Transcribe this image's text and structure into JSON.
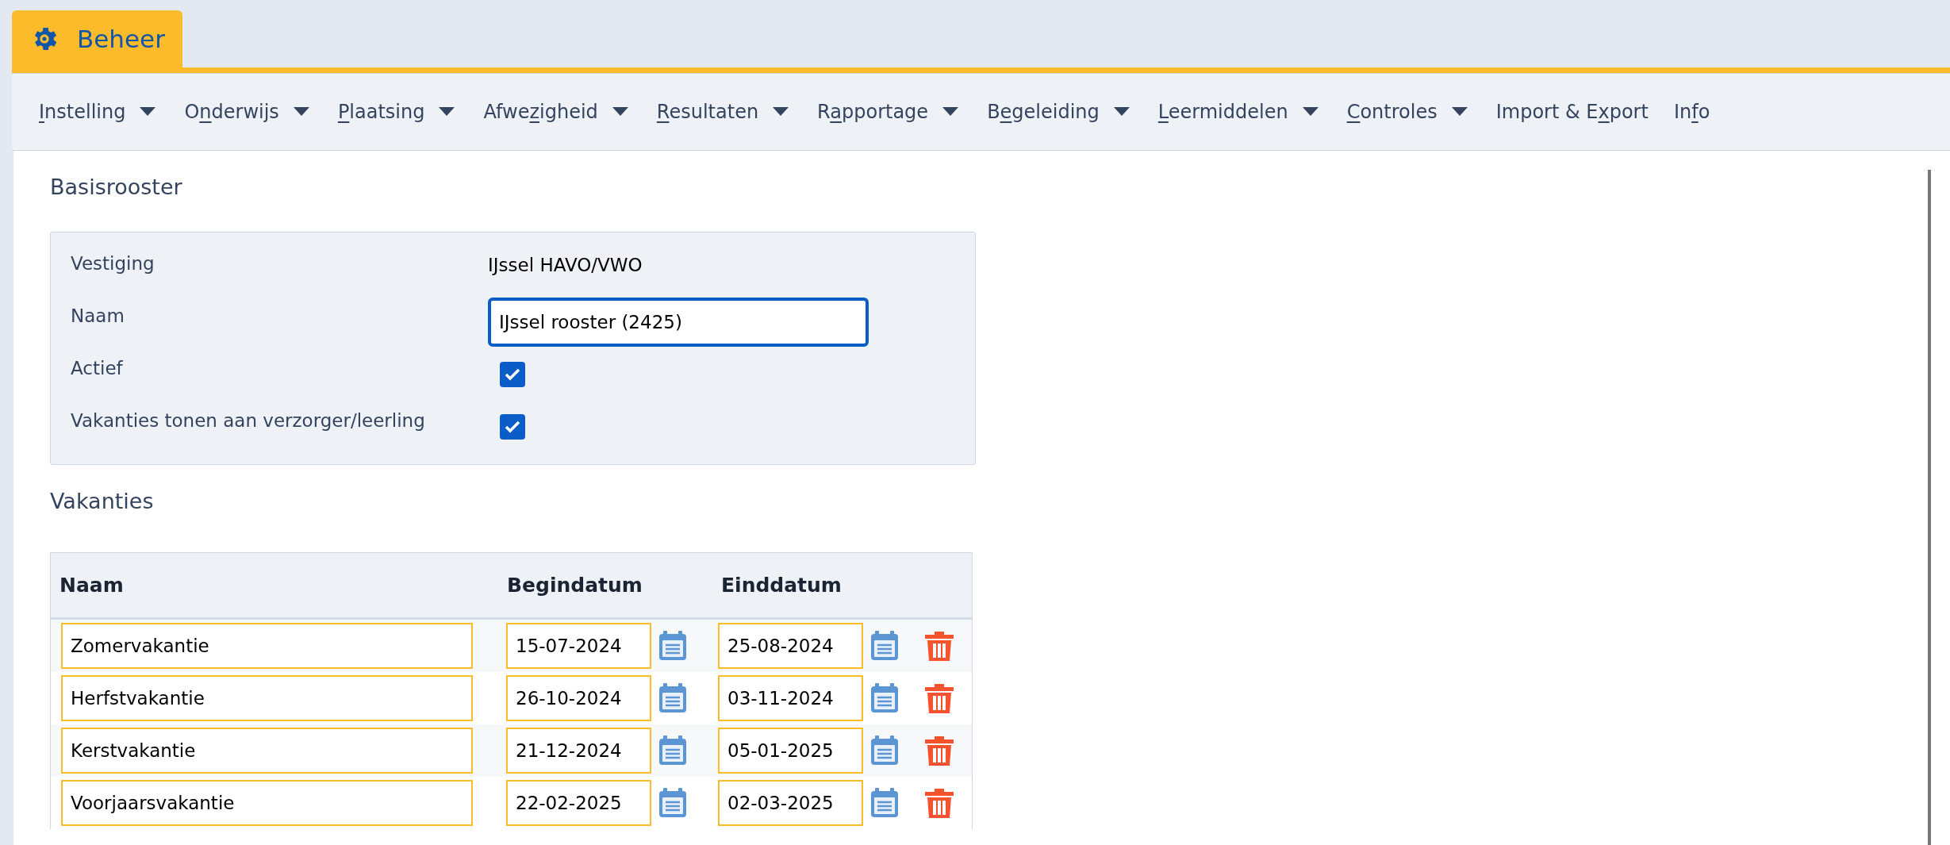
{
  "app_tab": {
    "label": "Beheer",
    "selected": true
  },
  "menu": [
    {
      "key": "I",
      "post": "nstelling",
      "dropdown": true
    },
    {
      "pre": "O",
      "key": "n",
      "post": "derwijs",
      "dropdown": true
    },
    {
      "key": "P",
      "post": "laatsing",
      "dropdown": true
    },
    {
      "pre": "Afwe",
      "key": "z",
      "post": "igheid",
      "dropdown": true
    },
    {
      "key": "R",
      "post": "esultaten",
      "dropdown": true
    },
    {
      "pre": "R",
      "key": "a",
      "post": "pportage",
      "dropdown": true
    },
    {
      "pre": "B",
      "key": "e",
      "post": "geleiding",
      "dropdown": true
    },
    {
      "key": "L",
      "post": "eermiddelen",
      "dropdown": true
    },
    {
      "key": "C",
      "post": "ontroles",
      "dropdown": true
    },
    {
      "pre": "Import & E",
      "key": "x",
      "post": "port",
      "dropdown": false
    },
    {
      "pre": "In",
      "key": "f",
      "post": "o",
      "dropdown": false
    }
  ],
  "basisrooster": {
    "title": "Basisrooster",
    "fields": [
      {
        "kind": "text",
        "label": "Vestiging",
        "value": "IJssel HAVO/VWO"
      },
      {
        "kind": "input",
        "label": "Naam",
        "value": "IJssel rooster (2425)",
        "focused": true
      },
      {
        "kind": "checkbox",
        "label": "Actief",
        "checked": true
      },
      {
        "kind": "checkbox",
        "label": "Vakanties tonen aan verzorger/leerling",
        "checked": true
      }
    ]
  },
  "vakanties": {
    "title": "Vakanties",
    "columns": [
      "Naam",
      "Begindatum",
      "Einddatum"
    ],
    "rows": [
      {
        "naam": "Zomervakantie",
        "begindatum": "15-07-2024",
        "einddatum": "25-08-2024"
      },
      {
        "naam": "Herfstvakantie",
        "begindatum": "26-10-2024",
        "einddatum": "03-11-2024"
      },
      {
        "naam": "Kerstvakantie",
        "begindatum": "21-12-2024",
        "einddatum": "05-01-2025"
      },
      {
        "naam": "Voorjaarsvakantie",
        "begindatum": "22-02-2025",
        "einddatum": "02-03-2025"
      }
    ]
  }
}
